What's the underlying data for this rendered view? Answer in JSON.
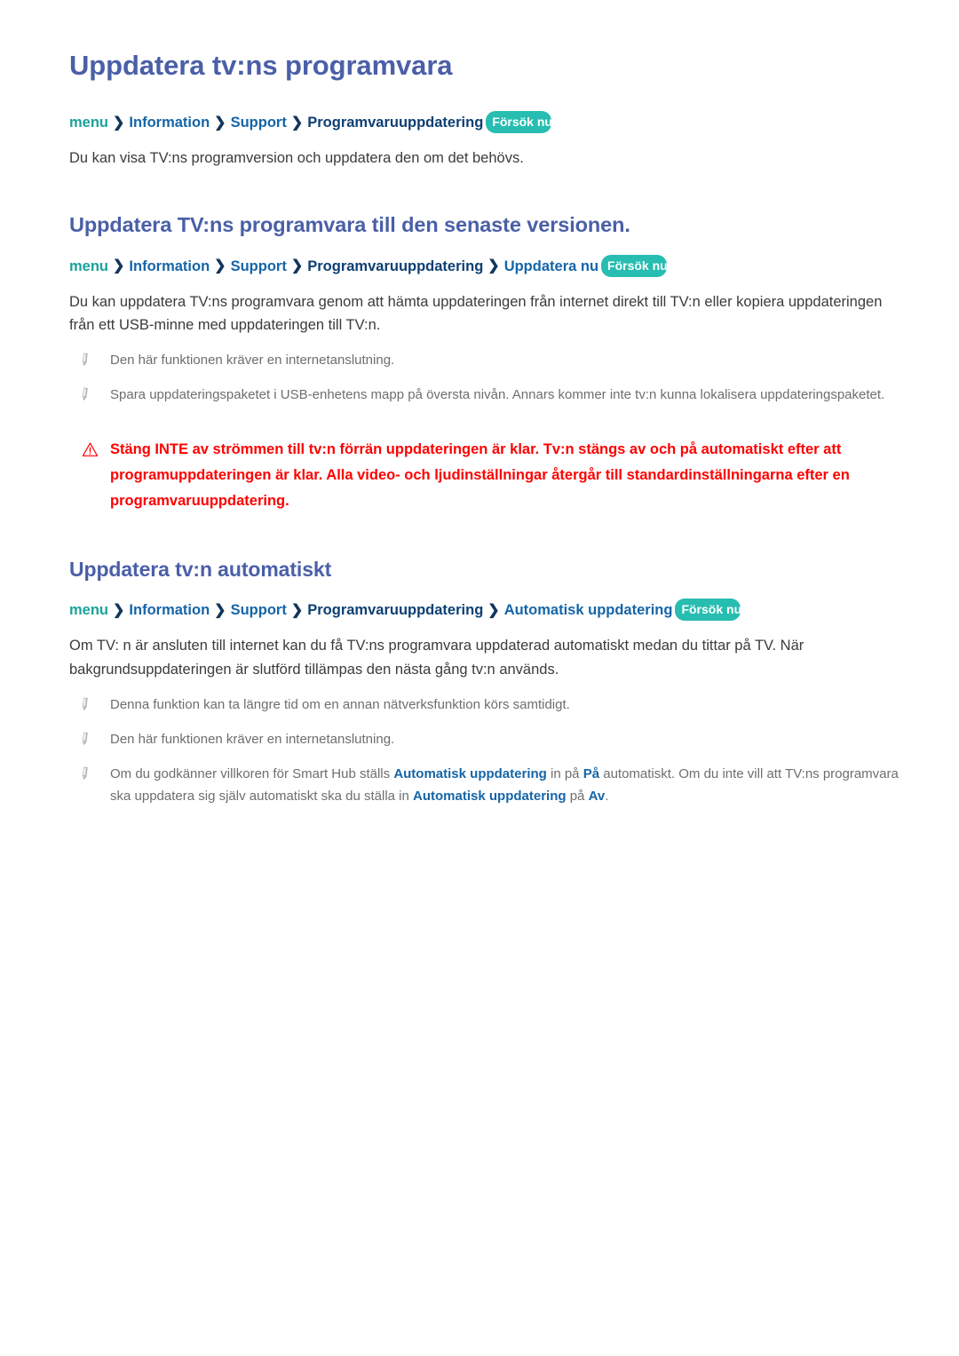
{
  "document": {
    "title": "Uppdatera tv:ns programvara",
    "badge_label": "Försök nu",
    "chevron": "❯"
  },
  "colors": {
    "heading": "#4a5fa8",
    "crumb_menu": "#1aa39a",
    "crumb_link": "#1565a8",
    "crumb_dark": "#0d3f73",
    "badge_bg": "#27bdb0",
    "body_text": "#3b3b3b",
    "note_text": "#6e6e6e",
    "caution_text": "#fe0000"
  },
  "sections": [
    {
      "id": "update-tv-software",
      "heading": "Uppdatera tv:ns programvara",
      "heading_level": "h1",
      "breadcrumb": [
        {
          "label": "menu",
          "style": "menu"
        },
        {
          "label": "Information",
          "style": "mid"
        },
        {
          "label": "Support",
          "style": "mid"
        },
        {
          "label": "Programvaruuppdatering",
          "style": "dark"
        }
      ],
      "badge": "Försök nu",
      "paragraphs": [
        "Du kan visa TV:ns programversion och uppdatera den om det behövs."
      ]
    },
    {
      "id": "update-to-latest",
      "heading": "Uppdatera TV:ns programvara till den senaste versionen.",
      "heading_level": "h2",
      "breadcrumb": [
        {
          "label": "menu",
          "style": "menu"
        },
        {
          "label": "Information",
          "style": "mid"
        },
        {
          "label": "Support",
          "style": "mid"
        },
        {
          "label": "Programvaruuppdatering",
          "style": "dark"
        },
        {
          "label": "Uppdatera nu",
          "style": "mid"
        }
      ],
      "badge": "Försök nu",
      "paragraphs": [
        "Du kan uppdatera TV:ns programvara genom att hämta uppdateringen från internet direkt till TV:n eller kopiera uppdateringen från ett USB-minne med uppdateringen till TV:n."
      ],
      "notes": [
        "Den här funktionen kräver en internetanslutning.",
        "Spara uppdateringspaketet i USB-enhetens mapp på översta nivån. Annars kommer inte tv:n kunna lokalisera uppdateringspaketet."
      ],
      "caution": "Stäng INTE av strömmen till tv:n förrän uppdateringen är klar. Tv:n stängs av och på automatiskt efter att programuppdateringen är klar. Alla video- och ljudinställningar återgår till standardinställningarna efter en programvaruuppdatering."
    },
    {
      "id": "auto-update",
      "heading": "Uppdatera tv:n automatiskt",
      "heading_level": "h2",
      "breadcrumb": [
        {
          "label": "menu",
          "style": "menu"
        },
        {
          "label": "Information",
          "style": "mid"
        },
        {
          "label": "Support",
          "style": "mid"
        },
        {
          "label": "Programvaruuppdatering",
          "style": "dark"
        },
        {
          "label": "Automatisk uppdatering",
          "style": "mid"
        }
      ],
      "badge": "Försök nu",
      "paragraphs": [
        "Om TV: n är ansluten till internet kan du få TV:ns programvara uppdaterad automatiskt medan du tittar på TV. När bakgrundsuppdateringen är slutförd tillämpas den nästa gång tv:n används."
      ],
      "notes": [
        "Denna funktion kan ta längre tid om en annan nätverksfunktion körs samtidigt.",
        "Den här funktionen kräver en internetanslutning."
      ],
      "rich_note": {
        "part1": "Om du godkänner villkoren för Smart Hub ställs ",
        "bold1": "Automatisk uppdatering",
        "part2": " in på ",
        "bold2": "På",
        "part3": " automatiskt. Om du inte vill att TV:ns programvara ska uppdatera sig själv automatiskt ska du ställa in ",
        "bold3": "Automatisk uppdatering",
        "part4": " på ",
        "bold4": "Av",
        "part5": "."
      }
    }
  ]
}
